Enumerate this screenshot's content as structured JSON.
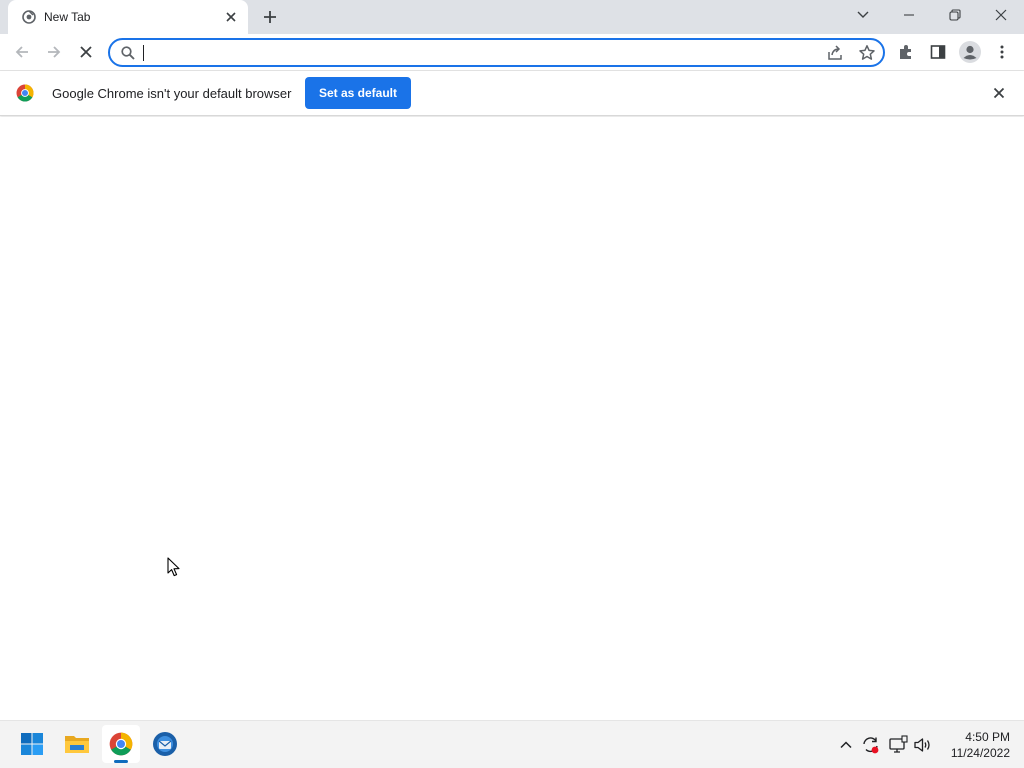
{
  "browser": {
    "tab": {
      "title": "New Tab",
      "favicon": "new-tab-icon"
    },
    "window_controls": [
      "tab-search-icon",
      "minimize-icon",
      "restore-icon",
      "close-icon"
    ],
    "omnibox": {
      "value": "",
      "placeholder": ""
    },
    "toolbar_icons": [
      "share-icon",
      "bookmark-star-icon",
      "extensions-icon",
      "side-panel-icon",
      "profile-icon",
      "menu-icon"
    ]
  },
  "infobar": {
    "message": "Google Chrome isn't your default browser",
    "button_label": "Set as default"
  },
  "taskbar": {
    "apps": [
      "start-icon",
      "file-explorer-icon",
      "chrome-icon",
      "thunderbird-icon"
    ],
    "active_app": "chrome-icon",
    "tray_icons": [
      "chevron-up-icon",
      "sync-icon",
      "network-icon",
      "volume-icon"
    ],
    "clock": {
      "time": "4:50 PM",
      "date": "11/24/2022"
    }
  },
  "colors": {
    "accent": "#1a73e8",
    "tabstrip": "#dee1e6",
    "taskbar": "#f3f3f3"
  }
}
